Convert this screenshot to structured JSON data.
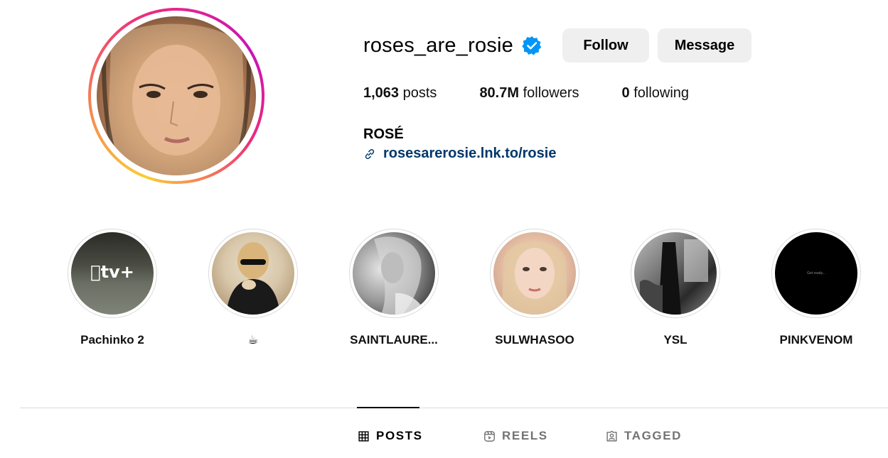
{
  "profile": {
    "username": "roses_are_rosie",
    "verified": true,
    "full_name": "ROSÉ",
    "link": "rosesarerosie.lnk.to/rosie",
    "stats": {
      "posts_count": "1,063",
      "posts_label": "posts",
      "followers_count": "80.7M",
      "followers_label": "followers",
      "following_count": "0",
      "following_label": "following"
    }
  },
  "actions": {
    "follow_label": "Follow",
    "message_label": "Message"
  },
  "highlights": [
    {
      "label": "Pachinko 2",
      "overlay": "tv+"
    },
    {
      "label": "☕"
    },
    {
      "label": "SAINTLAURE..."
    },
    {
      "label": "SULWHASOO"
    },
    {
      "label": "YSL"
    },
    {
      "label": "PINKVENOM",
      "overlay": "Get ready..."
    }
  ],
  "tabs": [
    {
      "label": "POSTS",
      "icon": "grid-icon",
      "active": true
    },
    {
      "label": "REELS",
      "icon": "reels-icon",
      "active": false
    },
    {
      "label": "TAGGED",
      "icon": "tagged-icon",
      "active": false
    }
  ],
  "colors": {
    "verified_blue": "#0095f6",
    "link_blue": "#00376b",
    "button_bg": "#efefef",
    "inactive_tab": "#737373"
  }
}
